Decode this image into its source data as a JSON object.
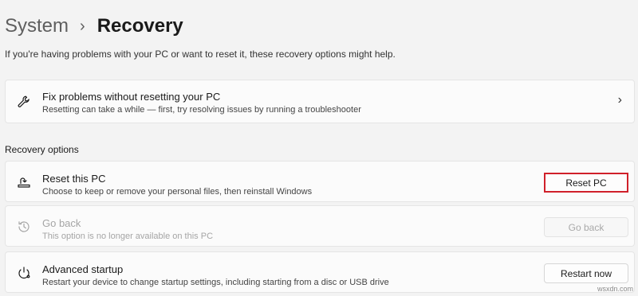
{
  "header": {
    "breadcrumb_parent": "System",
    "breadcrumb_separator": "›",
    "breadcrumb_current": "Recovery"
  },
  "subtitle": "If you're having problems with your PC or want to reset it, these recovery options might help.",
  "troubleshoot_card": {
    "title": "Fix problems without resetting your PC",
    "description": "Resetting can take a while — first, try resolving issues by running a troubleshooter",
    "icon": "wrench-icon",
    "chevron": "›"
  },
  "recovery_options": {
    "heading": "Recovery options",
    "items": [
      {
        "title": "Reset this PC",
        "description": "Choose to keep or remove your personal files, then reinstall Windows",
        "icon": "reset-pc-icon",
        "button_label": "Reset PC",
        "highlighted": true,
        "disabled": false
      },
      {
        "title": "Go back",
        "description": "This option is no longer available on this PC",
        "icon": "history-icon",
        "button_label": "Go back",
        "highlighted": false,
        "disabled": true
      },
      {
        "title": "Advanced startup",
        "description": "Restart your device to change startup settings, including starting from a disc or USB drive",
        "icon": "advanced-startup-icon",
        "button_label": "Restart now",
        "highlighted": false,
        "disabled": false
      }
    ]
  },
  "watermark": "wsxdn.com",
  "colors": {
    "background": "#f3f3f3",
    "card": "#fbfbfb",
    "highlight_border": "#d0202a",
    "disabled_text": "#a5a5a5"
  }
}
